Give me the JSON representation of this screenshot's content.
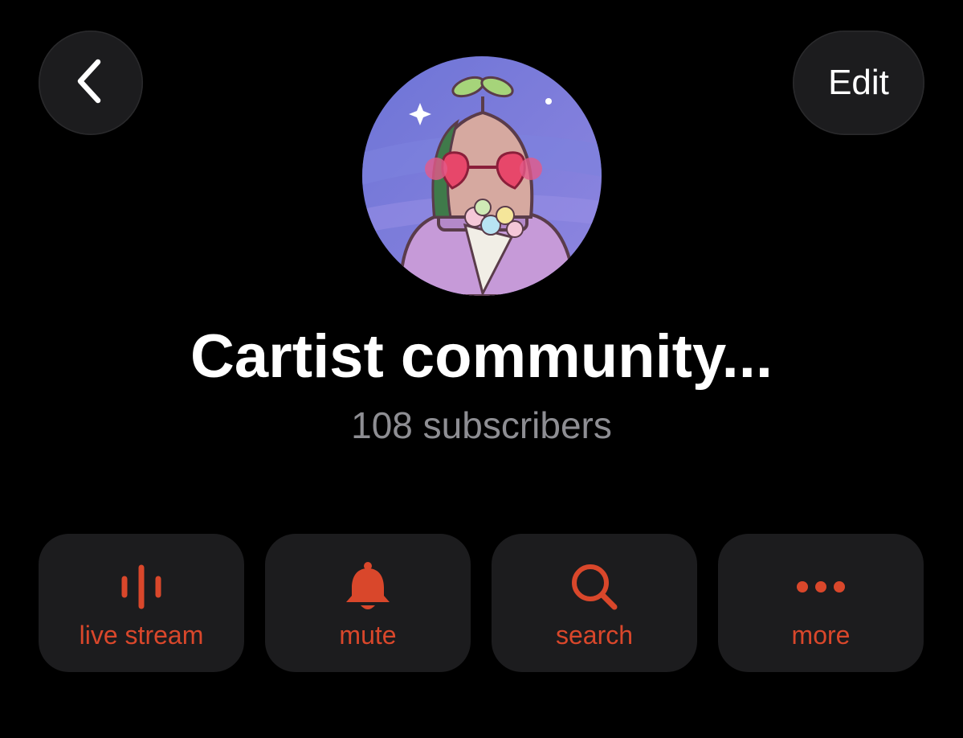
{
  "header": {
    "back_icon": "chevron-left-icon",
    "edit_label": "Edit"
  },
  "channel": {
    "avatar_description_icon": "avatar-image",
    "title": "Cartist community...",
    "subscribers": "108 subscribers"
  },
  "actions": [
    {
      "label": "live stream",
      "icon": "live-stream-icon"
    },
    {
      "label": "mute",
      "icon": "bell-icon"
    },
    {
      "label": "search",
      "icon": "search-icon"
    },
    {
      "label": "more",
      "icon": "more-dots-icon"
    }
  ],
  "colors": {
    "background": "#000000",
    "button_bg": "#1c1c1e",
    "accent": "#d9472b",
    "secondary_text": "#8e8e93",
    "primary_text": "#ffffff"
  }
}
